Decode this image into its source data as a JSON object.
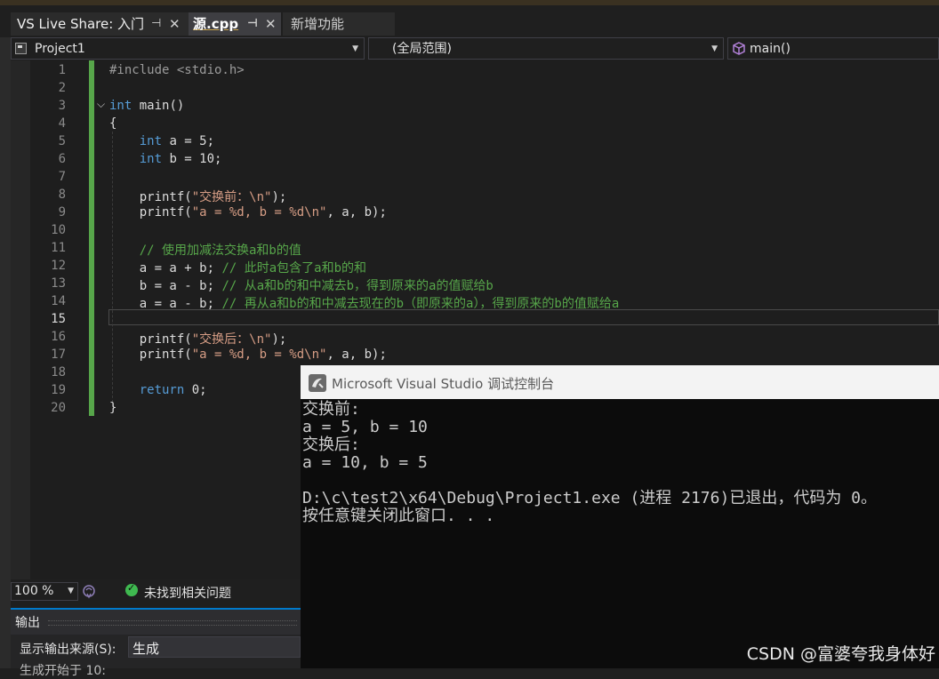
{
  "tabs": [
    {
      "label": "VS Live Share: 入门",
      "pin": "⊣",
      "close": "✕"
    },
    {
      "label": "源.cpp",
      "pin": "⊣",
      "close": "✕"
    },
    {
      "label": "新增功能"
    }
  ],
  "nav": {
    "project": "Project1",
    "scope": "(全局范围)",
    "member": "main()"
  },
  "editor": {
    "line_numbers": [
      "1",
      "2",
      "3",
      "4",
      "5",
      "6",
      "7",
      "8",
      "9",
      "10",
      "11",
      "12",
      "13",
      "14",
      "15",
      "16",
      "17",
      "18",
      "19",
      "20"
    ],
    "current_line": "15",
    "lines": [
      {
        "n": "1",
        "parts": [
          {
            "t": "#include <stdio.h>",
            "c": "#9b9b9b"
          }
        ]
      },
      {
        "n": "2",
        "parts": []
      },
      {
        "n": "3",
        "parts": [
          {
            "t": "int",
            "c": "#569cd6"
          },
          {
            "t": " main()",
            "c": "#dcdcdc"
          }
        ]
      },
      {
        "n": "4",
        "parts": [
          {
            "t": "{",
            "c": "#dcdcdc"
          }
        ]
      },
      {
        "n": "5",
        "parts": [
          {
            "t": "    int",
            "c": "#569cd6"
          },
          {
            "t": " a = 5;",
            "c": "#dcdcdc"
          }
        ]
      },
      {
        "n": "6",
        "parts": [
          {
            "t": "    int",
            "c": "#569cd6"
          },
          {
            "t": " b = 10;",
            "c": "#dcdcdc"
          }
        ]
      },
      {
        "n": "7",
        "parts": []
      },
      {
        "n": "8",
        "parts": [
          {
            "t": "    printf(",
            "c": "#dcdcdc"
          },
          {
            "t": "\"交换前：\\n\"",
            "c": "#d69d85"
          },
          {
            "t": ");",
            "c": "#dcdcdc"
          }
        ]
      },
      {
        "n": "9",
        "parts": [
          {
            "t": "    printf(",
            "c": "#dcdcdc"
          },
          {
            "t": "\"a = %d, b = %d\\n\"",
            "c": "#d69d85"
          },
          {
            "t": ", a, b);",
            "c": "#dcdcdc"
          }
        ]
      },
      {
        "n": "10",
        "parts": []
      },
      {
        "n": "11",
        "parts": [
          {
            "t": "    // 使用加减法交换a和b的值",
            "c": "#57a64a"
          }
        ]
      },
      {
        "n": "12",
        "parts": [
          {
            "t": "    a = a + b; ",
            "c": "#dcdcdc"
          },
          {
            "t": "// 此时a包含了a和b的和",
            "c": "#57a64a"
          }
        ]
      },
      {
        "n": "13",
        "parts": [
          {
            "t": "    b = a - b; ",
            "c": "#dcdcdc"
          },
          {
            "t": "// 从a和b的和中减去b，得到原来的a的值赋给b",
            "c": "#57a64a"
          }
        ]
      },
      {
        "n": "14",
        "parts": [
          {
            "t": "    a = a - b; ",
            "c": "#dcdcdc"
          },
          {
            "t": "// 再从a和b的和中减去现在的b（即原来的a），得到原来的b的值赋给a",
            "c": "#57a64a"
          }
        ]
      },
      {
        "n": "15",
        "parts": []
      },
      {
        "n": "16",
        "parts": [
          {
            "t": "    printf(",
            "c": "#dcdcdc"
          },
          {
            "t": "\"交换后：\\n\"",
            "c": "#d69d85"
          },
          {
            "t": ");",
            "c": "#dcdcdc"
          }
        ]
      },
      {
        "n": "17",
        "parts": [
          {
            "t": "    printf(",
            "c": "#dcdcdc"
          },
          {
            "t": "\"a = %d, b = %d\\n\"",
            "c": "#d69d85"
          },
          {
            "t": ", a, b);",
            "c": "#dcdcdc"
          }
        ]
      },
      {
        "n": "18",
        "parts": []
      },
      {
        "n": "19",
        "parts": [
          {
            "t": "    return",
            "c": "#569cd6"
          },
          {
            "t": " 0;",
            "c": "#dcdcdc"
          }
        ]
      },
      {
        "n": "20",
        "parts": [
          {
            "t": "}",
            "c": "#dcdcdc"
          }
        ]
      }
    ]
  },
  "status": {
    "zoom": "100 %",
    "issues": "未找到相关问题"
  },
  "output": {
    "title": "输出",
    "source_label": "显示输出来源(S):",
    "source_value": "生成",
    "partial_line": "生成开始于 10:"
  },
  "console": {
    "title": "Microsoft Visual Studio 调试控制台",
    "lines": [
      "交换前:",
      "a = 5, b = 10",
      "交换后:",
      "a = 10, b = 5",
      "",
      "D:\\c\\test2\\x64\\Debug\\Project1.exe (进程 2176)已退出，代码为 0。",
      "按任意键关闭此窗口. . ."
    ]
  },
  "watermark": "CSDN @富婆夸我身体好",
  "colors": {
    "keyword": "#569cd6",
    "string": "#d69d85",
    "comment": "#57a64a",
    "changebar": "#57a64a",
    "accent": "#007acc"
  }
}
